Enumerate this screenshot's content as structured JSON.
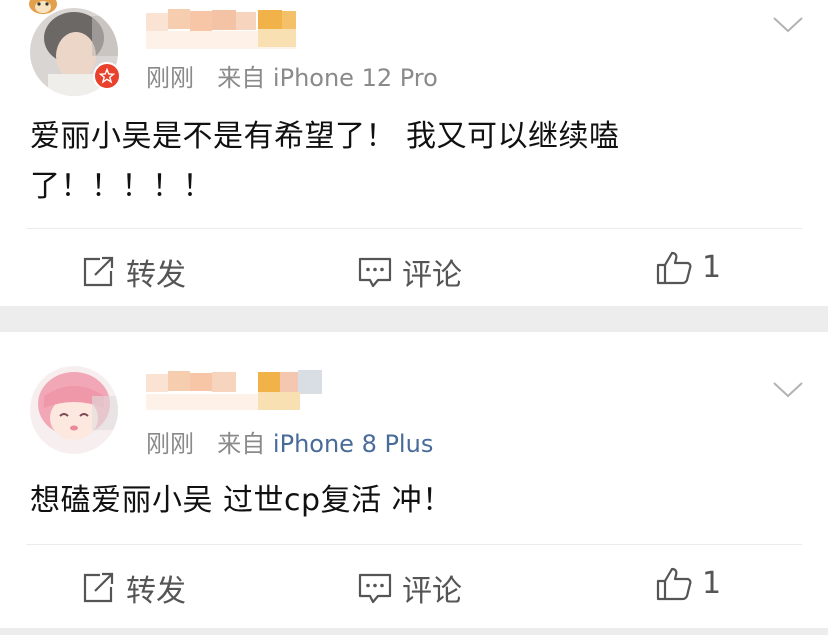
{
  "comments": [
    {
      "time": "刚刚",
      "source_prefix": "来自",
      "device": "iPhone 12 Pro",
      "text_line1": "爱丽小吴是不是有希望了！ 我又可以继续嗑",
      "text_line2": "了！！！！！",
      "actions": {
        "repost": "转发",
        "comment": "评论",
        "like_count": "1"
      }
    },
    {
      "time": "刚刚",
      "source_prefix": "来自",
      "device": "iPhone 8 Plus",
      "text_line1": "想磕爱丽小吴 过世cp复活 冲！",
      "actions": {
        "repost": "转发",
        "comment": "评论",
        "like_count": "1"
      }
    }
  ],
  "colors": {
    "background": "#ededed",
    "card": "#ffffff",
    "meta_gray": "#8a8a8a",
    "device_blue": "#486b99",
    "verified_badge": "#e8412c"
  },
  "icons": [
    "dog-avatar-icon",
    "verified-badge-icon",
    "chevron-down-icon",
    "repost-icon",
    "comment-icon",
    "thumbs-up-icon"
  ]
}
